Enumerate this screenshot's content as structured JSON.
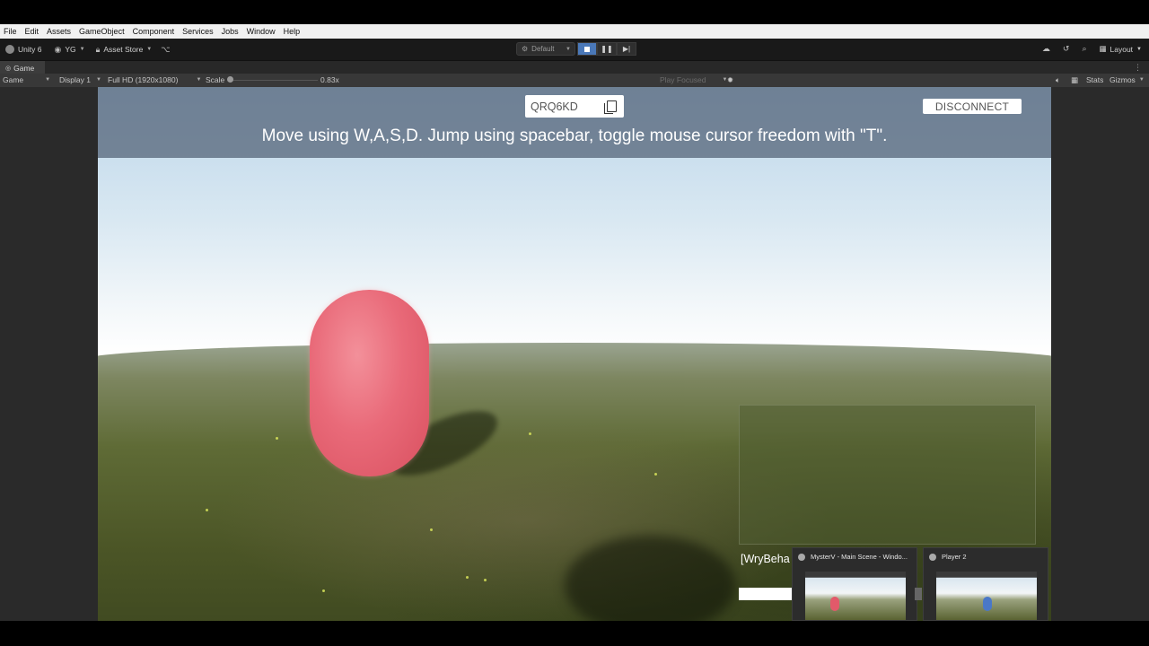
{
  "menu": [
    "File",
    "Edit",
    "Assets",
    "GameObject",
    "Component",
    "Services",
    "Jobs",
    "Window",
    "Help"
  ],
  "toolbar": {
    "unity_label": "Unity 6",
    "account_label": "YG",
    "asset_store_label": "Asset Store",
    "default_label": "Default",
    "layout_label": "Layout"
  },
  "tab": {
    "game_label": "Game"
  },
  "game_toolbar": {
    "view_label": "Game",
    "display_label": "Display 1",
    "resolution_label": "Full HD (1920x1080)",
    "scale_label": "Scale",
    "scale_value": "0.83x",
    "play_focused_label": "Play Focused",
    "stats_label": "Stats",
    "gizmos_label": "Gizmos"
  },
  "game": {
    "session_code": "QRQ6KD",
    "disconnect_label": "DISCONNECT",
    "instructions": "Move using W,A,S,D. Jump using spacebar, toggle mouse cursor freedom with \"T\".",
    "player_label": "[WryBeha"
  },
  "taskbar_previews": [
    {
      "title": "MysterV - Main Scene - Windo...",
      "capsule_color": "#e25a6a"
    },
    {
      "title": "Player 2",
      "capsule_color": "#4a78c8"
    }
  ],
  "colors": {
    "accent": "#4a78b8",
    "capsule": "#e96a79",
    "hud": "#506074"
  }
}
